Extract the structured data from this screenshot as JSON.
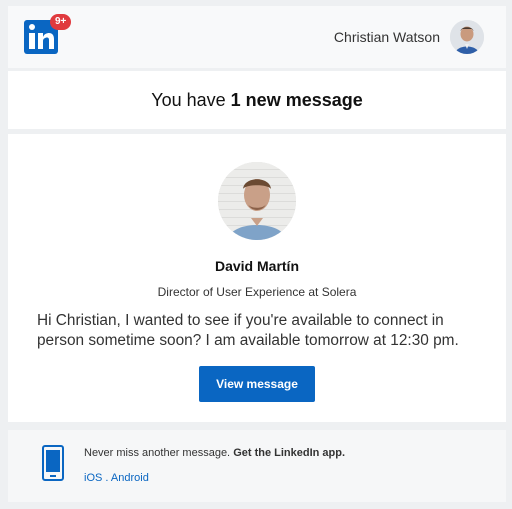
{
  "header": {
    "logo_text": "in",
    "notification_badge": "9+",
    "user_name": "Christian Watson",
    "brand_color": "#0a66c2"
  },
  "title": {
    "prefix": "You have",
    "bold": "1 new message"
  },
  "message": {
    "sender_name": "David Martín",
    "sender_title": "Director of User Experience at Solera",
    "body": "Hi Christian, I wanted to see if you're available to connect in person sometime soon? I am available tomorrow at 12:30 pm.",
    "button_label": "View message"
  },
  "promo": {
    "text": "Never miss another message.",
    "bold": "Get the LinkedIn app.",
    "ios_link": "iOS",
    "separator": ".",
    "android_link": "Android",
    "phone_icon": "mobile-phone-icon"
  }
}
